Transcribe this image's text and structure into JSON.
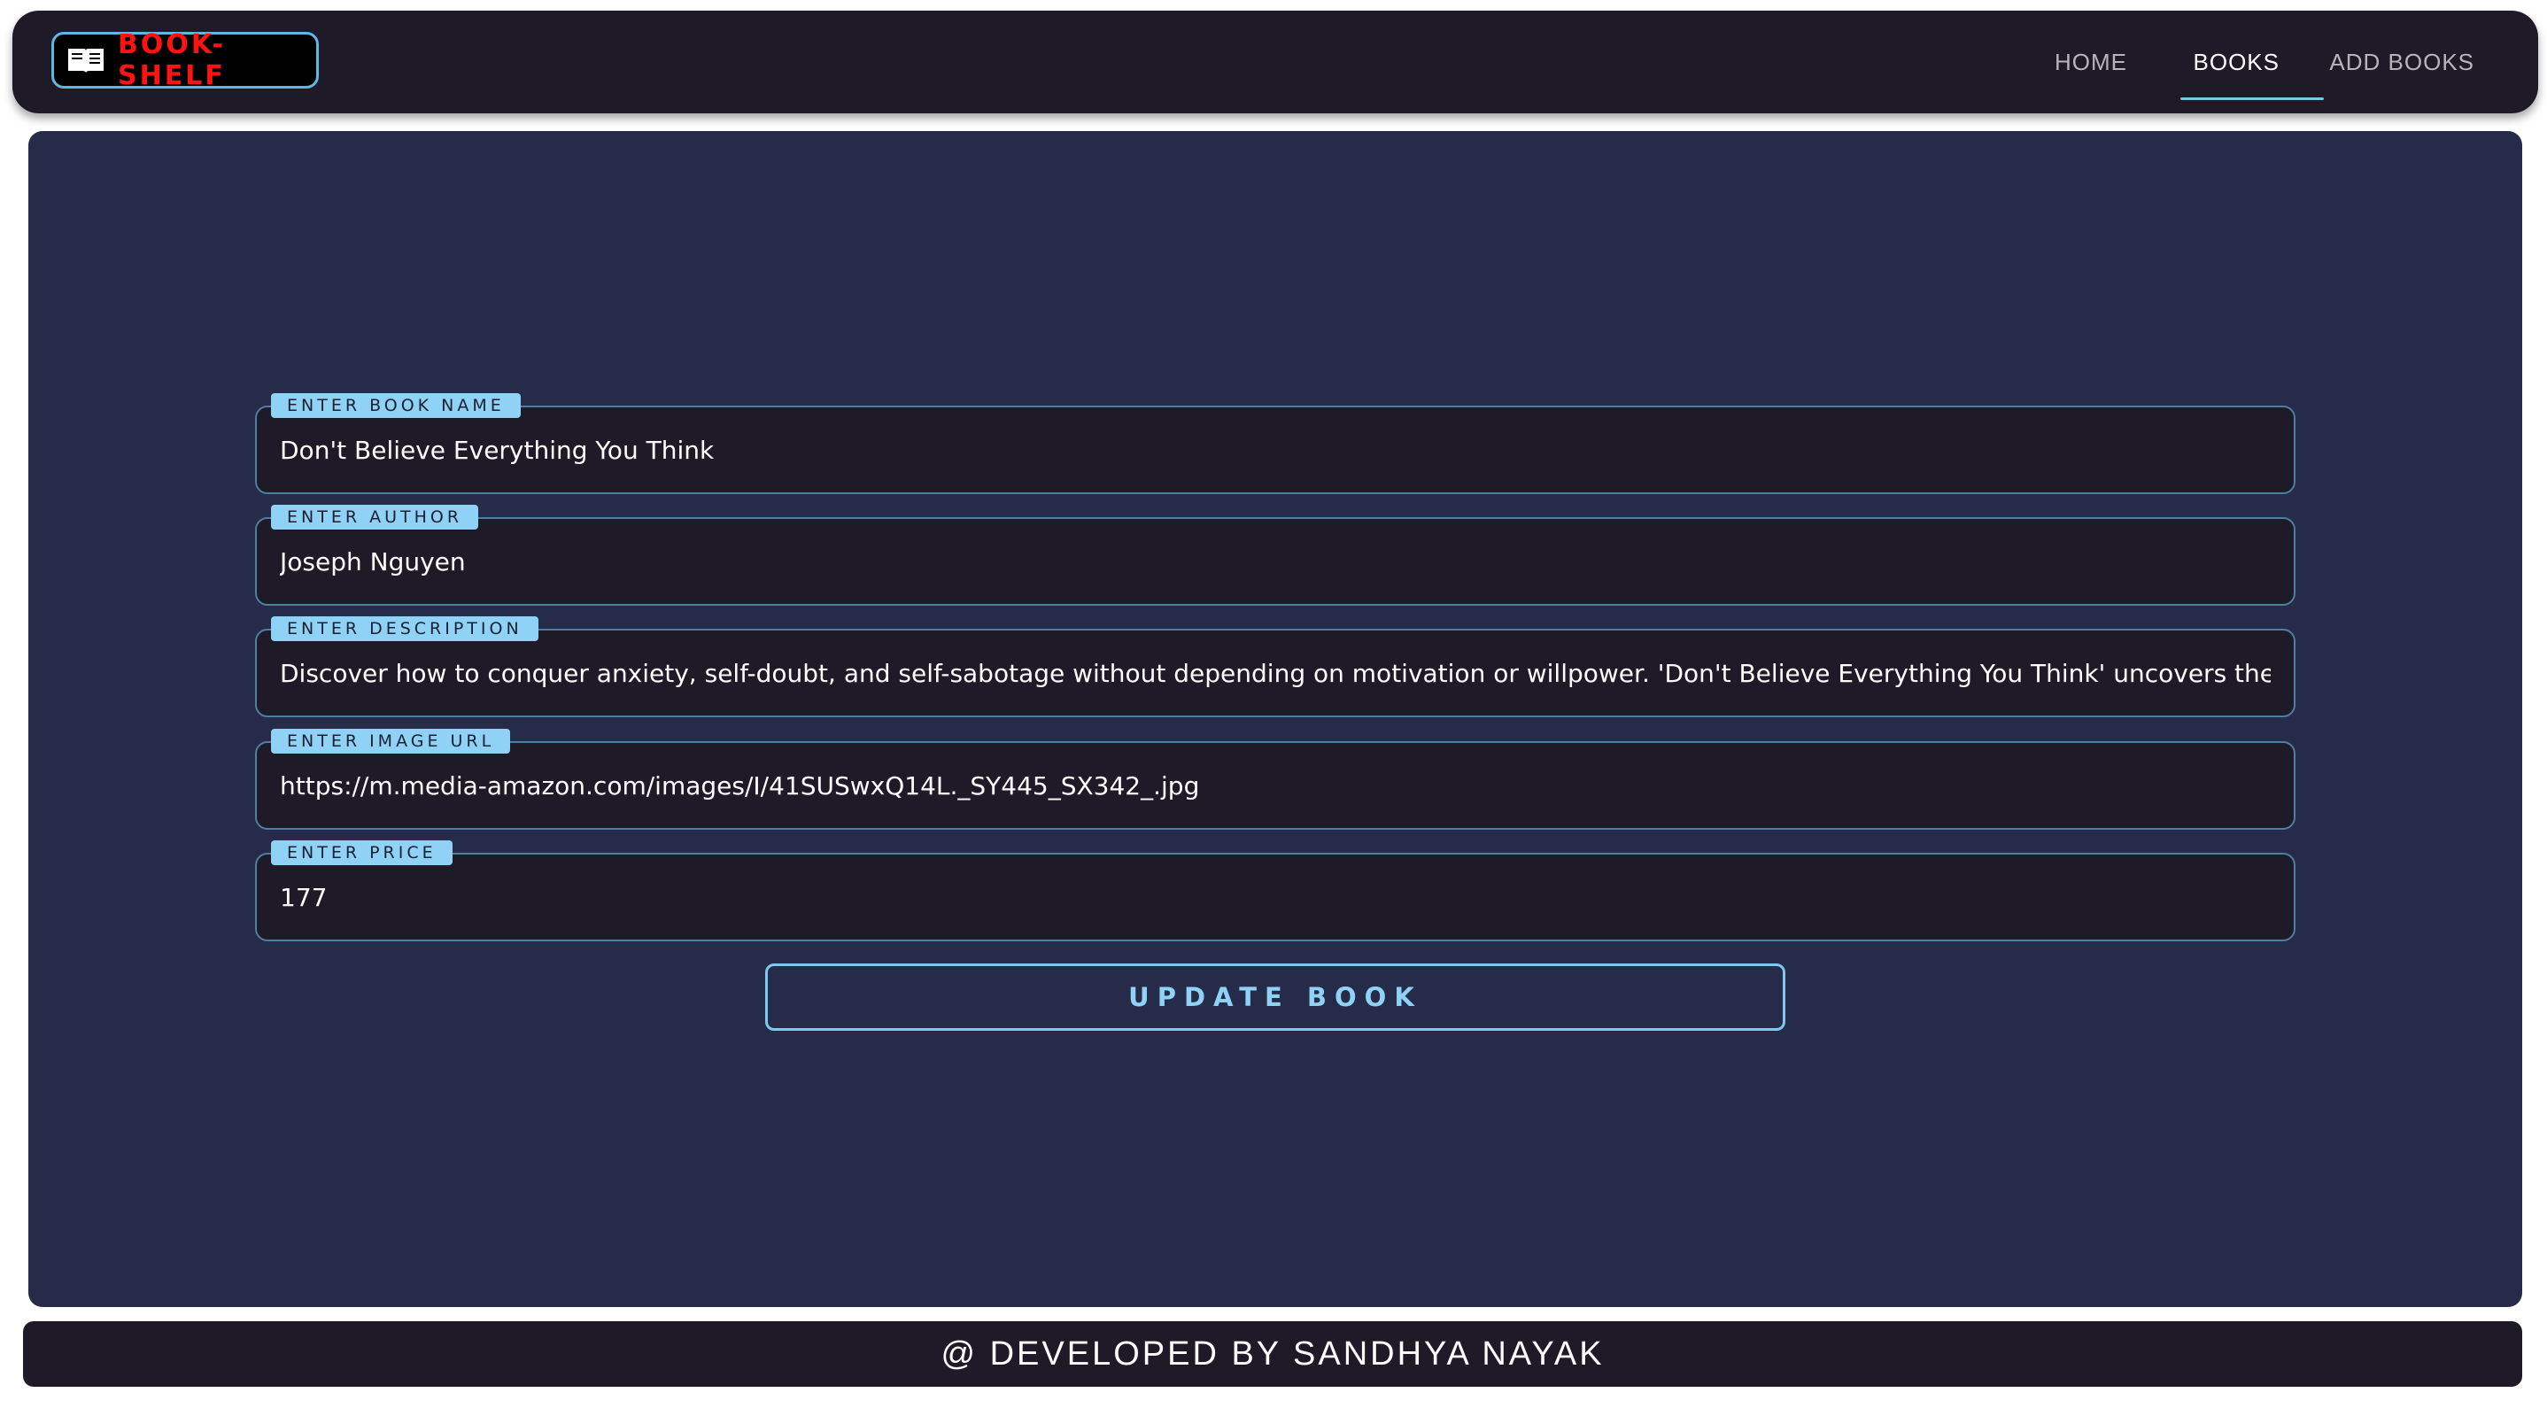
{
  "brand": {
    "name": "BOOK-SHELF",
    "icon": "open-book-icon",
    "color": "#ff1212"
  },
  "nav": {
    "home": "HOME",
    "books": "BOOKS",
    "add_books": "ADD BOOKS",
    "active": "BOOKS"
  },
  "form": {
    "book_name": {
      "label": "ENTER BOOK NAME",
      "value": "Don't Believe Everything You Think"
    },
    "author": {
      "label": "ENTER AUTHOR",
      "value": "Joseph Nguyen"
    },
    "description": {
      "label": "ENTER DESCRIPTION",
      "value": "Discover how to conquer anxiety, self-doubt, and self-sabotage without depending on motivation or willpower. 'Don't Believe Everything You Think' uncovers the core of psychological suffering"
    },
    "image_url": {
      "label": "ENTER IMAGE URL",
      "value": "https://m.media-amazon.com/images/I/41SUSwxQ14L._SY445_SX342_.jpg"
    },
    "price": {
      "label": "ENTER PRICE",
      "value": "177"
    },
    "submit_label": "UPDATE BOOK"
  },
  "footer": {
    "text": "@ DEVELOPED BY SANDHYA NAYAK"
  },
  "colors": {
    "navbar_bg": "#1f1a27",
    "panel_bg": "#252b49",
    "accent": "#8fd2f5",
    "field_border": "#4f7ea3"
  }
}
